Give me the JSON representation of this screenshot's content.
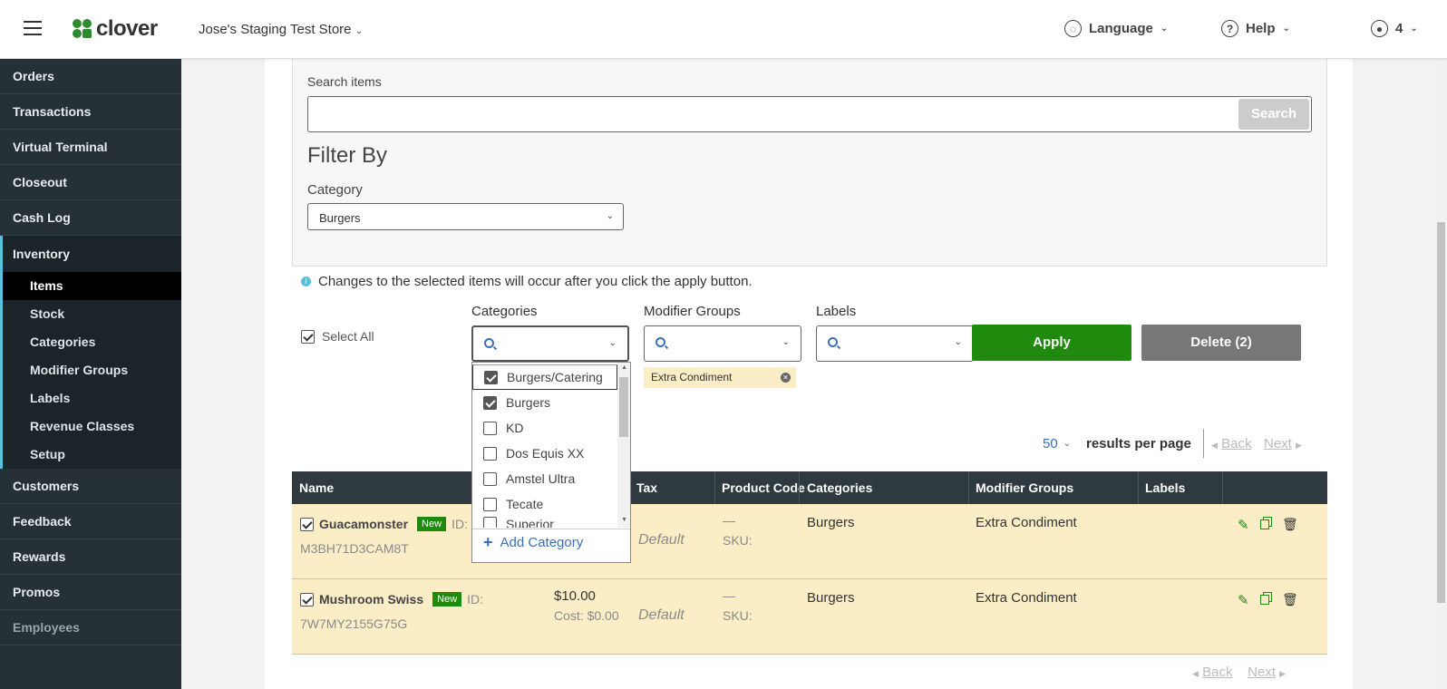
{
  "topbar": {
    "brand": "clover",
    "store_name": "Jose's Staging Test Store",
    "language": "Language",
    "help": "Help",
    "account": "4"
  },
  "sidebar": {
    "items_top": [
      "Orders",
      "Transactions",
      "Virtual Terminal",
      "Closeout",
      "Cash Log"
    ],
    "group": "Inventory",
    "sub_items": [
      "Items",
      "Stock",
      "Categories",
      "Modifier Groups",
      "Labels",
      "Revenue Classes",
      "Setup"
    ],
    "items_bottom": [
      "Customers",
      "Feedback",
      "Rewards",
      "Promos",
      "Employees"
    ]
  },
  "filter": {
    "search_label": "Search items",
    "search_button": "Search",
    "filter_title": "Filter By",
    "category_label": "Category",
    "category_value": "Burgers"
  },
  "bulk": {
    "info_text": "Changes to the selected items will occur after you click the apply button.",
    "select_all": "Select All",
    "categories_label": "Categories",
    "modifier_groups_label": "Modifier Groups",
    "labels_label": "Labels",
    "apply": "Apply",
    "delete": "Delete (2)",
    "modifier_tag": "Extra Condiment"
  },
  "category_dropdown": {
    "options": [
      {
        "label": "Burgers/Catering",
        "checked": true
      },
      {
        "label": "Burgers",
        "checked": true
      },
      {
        "label": "KD",
        "checked": false
      },
      {
        "label": "Dos Equis XX",
        "checked": false
      },
      {
        "label": "Amstel Ultra",
        "checked": false
      },
      {
        "label": "Tecate",
        "checked": false
      },
      {
        "label": "Superior",
        "checked": false
      }
    ],
    "add_label": "Add Category"
  },
  "pagination": {
    "per_page": "50",
    "per_page_label": "results per page",
    "back": "Back",
    "next": "Next"
  },
  "table": {
    "columns": [
      "Name",
      "Tax",
      "Product Code",
      "Categories",
      "Modifier Groups",
      "Labels"
    ],
    "rows": [
      {
        "name": "Guacamonster",
        "badge": "New",
        "id_label": "ID:",
        "id": "M3BH71D3CAM8T",
        "price": "",
        "cost": "",
        "tax": "Default",
        "product_code": "—",
        "sku": "SKU:",
        "categories": "Burgers",
        "modifier_groups": "Extra Condiment"
      },
      {
        "name": "Mushroom Swiss",
        "badge": "New",
        "id_label": "ID:",
        "id": "7W7MY2155G75G",
        "price": "$10.00",
        "cost": "Cost: $0.00",
        "tax": "Default",
        "product_code": "—",
        "sku": "SKU:",
        "categories": "Burgers",
        "modifier_groups": "Extra Condiment"
      }
    ]
  },
  "colors": {
    "brand_green": "#1f8a0d",
    "sidebar_bg": "#253037",
    "row_highlight": "#fbeec6",
    "link_blue": "#3b6fb6"
  }
}
